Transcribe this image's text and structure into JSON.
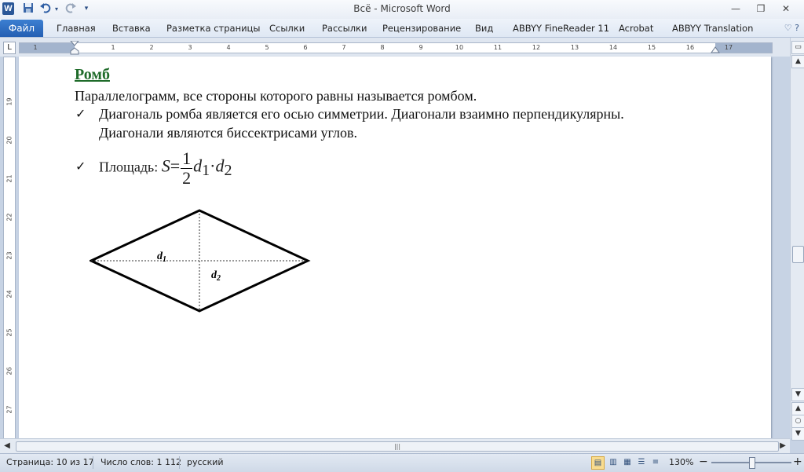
{
  "app": {
    "title": "Всё  -  Microsoft Word",
    "logo_letter": "W"
  },
  "qat": {
    "save_icon": "save-icon",
    "undo_icon": "undo-icon",
    "redo_icon": "redo-icon",
    "customize_icon": "chevron-down-icon"
  },
  "window_controls": {
    "minimize": "—",
    "restore": "❐",
    "close": "✕"
  },
  "ribbon": {
    "file_tab": "Файл",
    "tabs": [
      "Главная",
      "Вставка",
      "Разметка страницы",
      "Ссылки",
      "Рассылки",
      "Рецензирование",
      "Вид",
      "ABBYY FineReader 11",
      "Acrobat",
      "ABBYY Translation"
    ],
    "help": "♡  ?"
  },
  "ruler": {
    "corner_symbol": "L",
    "h_numbers": [
      "1",
      "1",
      "2",
      "3",
      "4",
      "5",
      "6",
      "7",
      "8",
      "9",
      "10",
      "11",
      "12",
      "13",
      "14",
      "15",
      "16",
      "17"
    ],
    "v_numbers": [
      "19",
      "20",
      "21",
      "22",
      "23",
      "24",
      "25",
      "26",
      "27"
    ]
  },
  "document": {
    "heading": "Ромб",
    "definition": "Параллелограмм, все стороны которого равны называется ромбом.",
    "check_mark": "✓",
    "bullet1_line1": "Диагональ ромба является его осью симметрии.  Диагонали взаимно перпендикулярны.",
    "bullet1_line2": "Диагонали являются биссектрисами углов.",
    "bullet2_label": "Площадь: ",
    "formula": {
      "lhs": "S",
      "equals": "=",
      "num": "1",
      "den": "2",
      "d": "d",
      "sub1": "1",
      "dot": "·",
      "sub2": "2"
    },
    "figure": {
      "diag1_label": "d",
      "diag1_sub": "1",
      "diag2_label": "d",
      "diag2_sub": "2"
    }
  },
  "status": {
    "page": "Страница: 10 из 17",
    "words": "Число слов: 1 112",
    "language": "русский",
    "zoom": "130%",
    "zoom_out": "−",
    "zoom_in": "+"
  }
}
